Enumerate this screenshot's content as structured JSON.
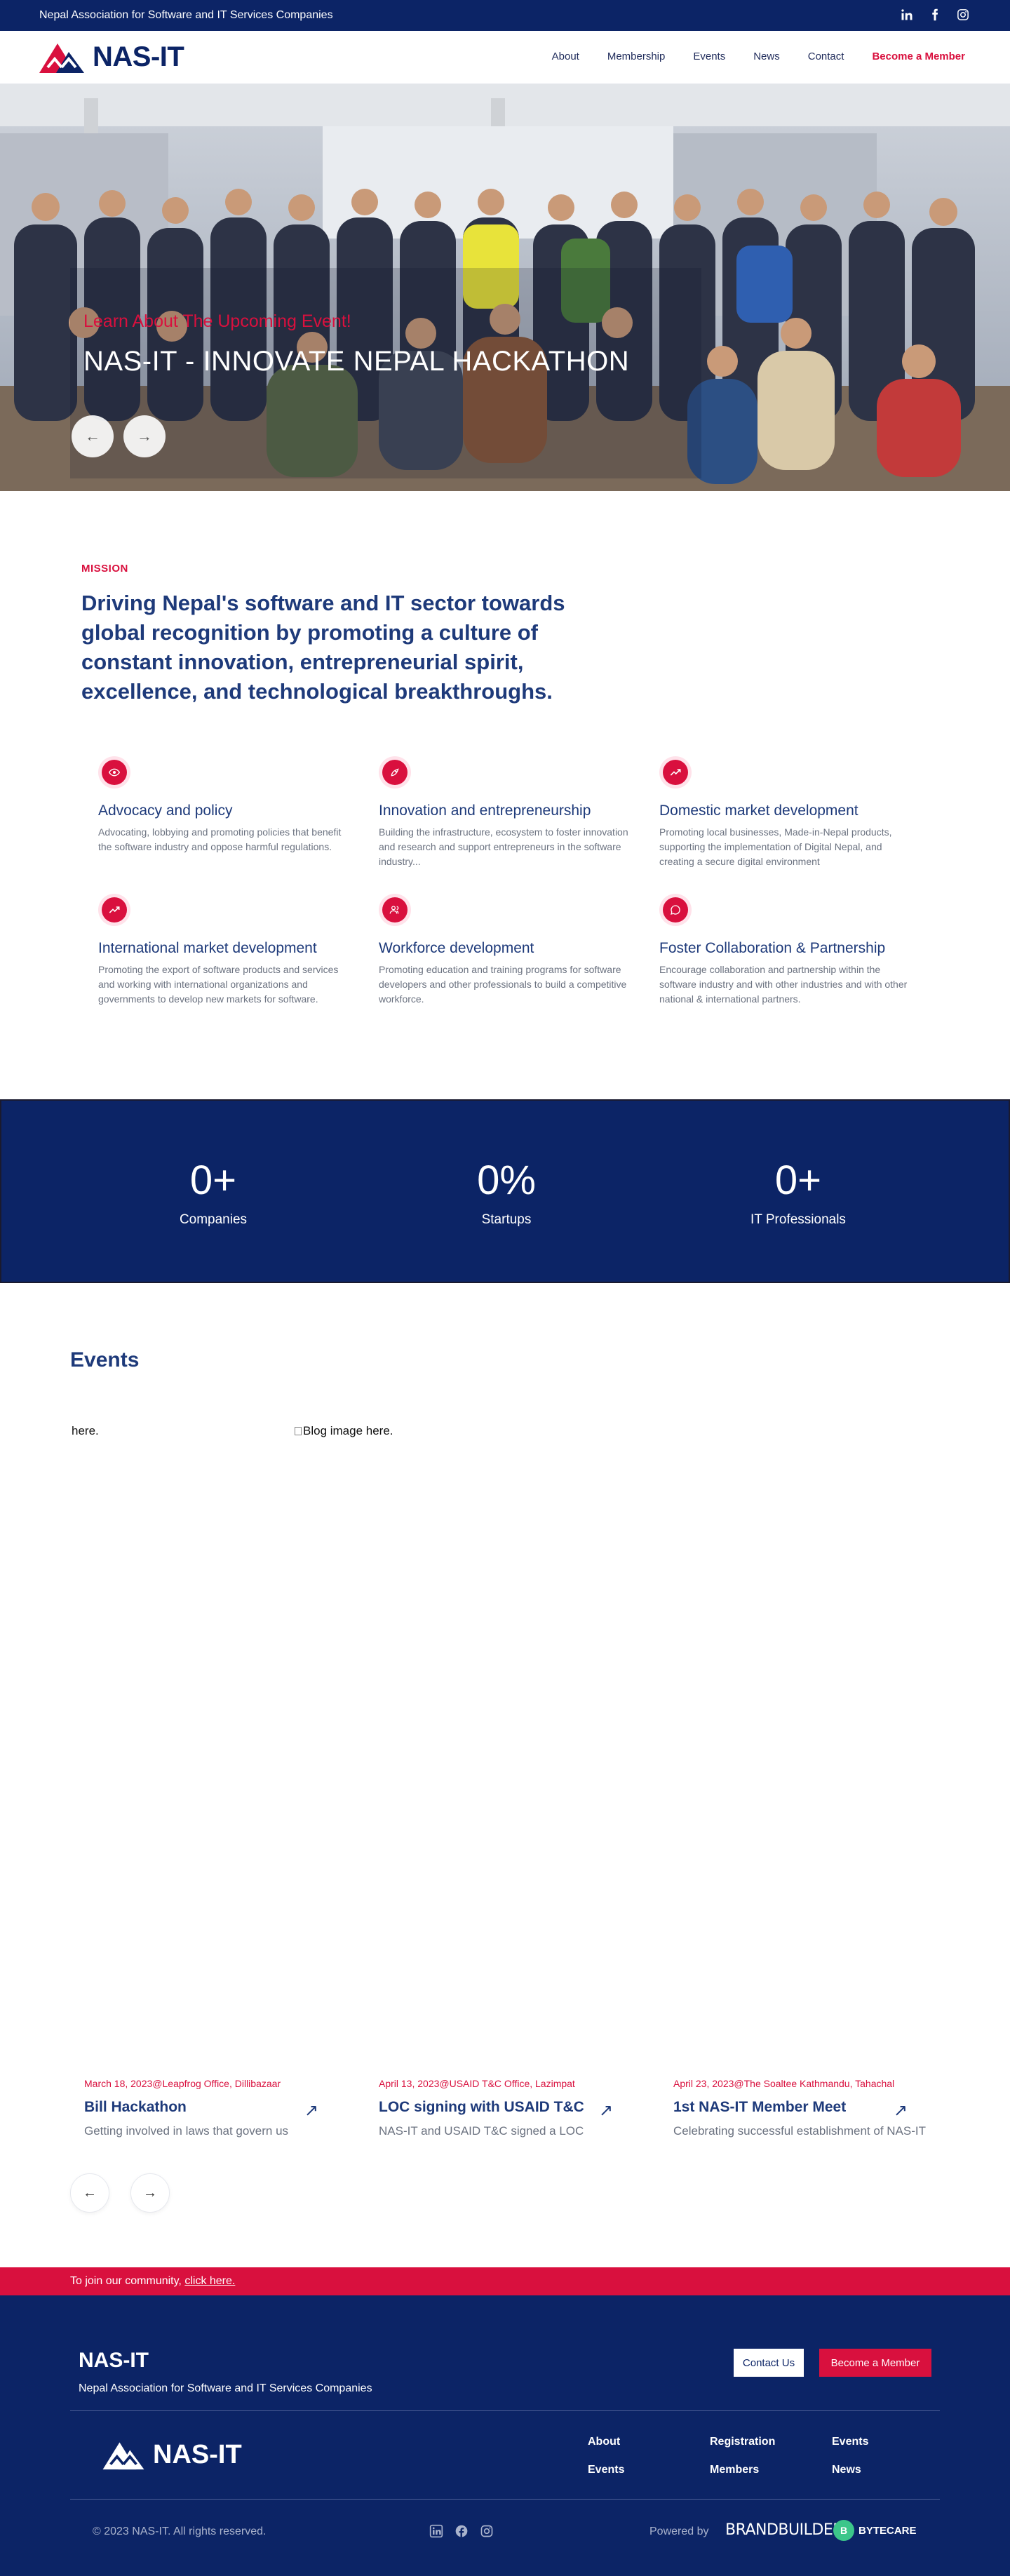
{
  "topbar": {
    "text": "Nepal Association for Software and IT Services Companies",
    "social_icons": [
      "linkedin-icon",
      "facebook-icon",
      "instagram-icon"
    ]
  },
  "header": {
    "logo_text": "NAS-IT",
    "nav": [
      "About",
      "Membership",
      "Events",
      "News",
      "Contact"
    ],
    "cta": "Become a Member"
  },
  "hero": {
    "kicker": "Learn About The Upcoming Event!",
    "title": "NAS-IT - INNOVATE NEPAL HACKATHON",
    "prev_icon": "arrow-left-icon",
    "next_icon": "arrow-right-icon"
  },
  "mission": {
    "label": "MISSION",
    "statement": "Driving Nepal's software and IT sector towards global recognition by promoting a culture of constant innovation, entrepreneurial spirit, excellence, and technological breakthroughs."
  },
  "features": [
    {
      "icon": "eye-icon",
      "title": "Advocacy and policy",
      "desc": "Advocating, lobbying and promoting policies that benefit the software industry and oppose harmful regulations."
    },
    {
      "icon": "rocket-icon",
      "title": "Innovation and entrepreneurship",
      "desc": "Building the infrastructure, ecosystem to foster innovation and research and support entrepreneurs in the software industry..."
    },
    {
      "icon": "trending-up-icon",
      "title": "Domestic market development",
      "desc": "Promoting local businesses, Made-in-Nepal products, supporting the implementation of Digital Nepal, and creating a secure digital environment"
    },
    {
      "icon": "trending-up-icon",
      "title": "International market development",
      "desc": "Promoting the export of software products and services and working with international organizations and governments to develop new markets for software."
    },
    {
      "icon": "users-icon",
      "title": "Workforce development",
      "desc": "Promoting education and training programs for software developers and other professionals to build a competitive workforce."
    },
    {
      "icon": "chat-icon",
      "title": "Foster Collaboration & Partnership",
      "desc": "Encourage collaboration and partnership within the software industry and with other industries and with other national & international partners."
    }
  ],
  "stats": [
    {
      "value": "0+",
      "label": "Companies"
    },
    {
      "value": "0%",
      "label": "Startups"
    },
    {
      "value": "0+",
      "label": "IT Professionals"
    }
  ],
  "events": {
    "title": "Events",
    "image_alts": [
      "here.",
      "Blog image here."
    ],
    "cards": [
      {
        "date": "March 18, 2023@Leapfrog Office, Dillibazaar",
        "title": "Bill Hackathon",
        "desc": "Getting involved in laws that govern us"
      },
      {
        "date": "April 13, 2023@USAID T&C Office, Lazimpat",
        "title": "LOC signing with USAID T&C",
        "desc": "NAS-IT and USAID T&C signed a LOC"
      },
      {
        "date": "April 23, 2023@The Soaltee Kathmandu, Tahachal",
        "title": "1st NAS-IT Member Meet",
        "desc": "Celebrating successful establishment of NAS-IT"
      }
    ]
  },
  "join": {
    "text": "To join our community, ",
    "link": "click here."
  },
  "footer": {
    "name": "NAS-IT",
    "subtitle": "Nepal Association for Software and IT Services Companies",
    "contact_button": "Contact Us",
    "member_button": "Become a Member",
    "logo_text": "NAS-IT",
    "links": [
      "About",
      "Registration",
      "Events",
      "Events",
      "Members",
      "News"
    ],
    "copyright": "© 2023 NAS-IT. All rights reserved.",
    "powered_by": "Powered by",
    "brandbuilder": "BRANDBUILDER",
    "bytecare": "BYTECARE"
  },
  "colors": {
    "navy": "#0c2466",
    "accent_red": "#d9103e",
    "heading_blue": "#1e3a7a",
    "muted_text": "#6b7280"
  }
}
